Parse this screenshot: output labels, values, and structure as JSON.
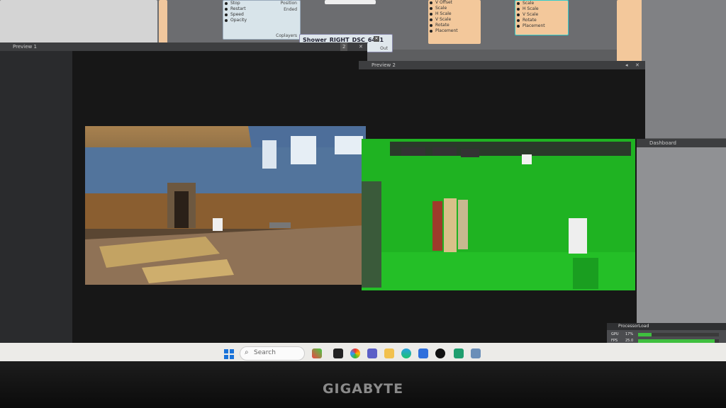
{
  "monitor": {
    "brand": "GIGABYTE"
  },
  "node_editor": {
    "node_c": {
      "ports": [
        "Stop",
        "Restart",
        "Speed",
        "Opacity"
      ],
      "outputs": [
        "Position",
        "Ended"
      ],
      "footer": "Coplayers"
    },
    "node_d": {
      "title": "Shower_RIGHT_DSC_6411",
      "output": "Out"
    },
    "node_f": {
      "ports": [
        "V Offset",
        "Scale",
        "H Scale",
        "V Scale",
        "Rotate",
        "Placement"
      ]
    },
    "node_g": {
      "ports": [
        "Scale",
        "H Scale",
        "V Scale",
        "Rotate",
        "Placement"
      ]
    }
  },
  "previews": [
    {
      "title": "Preview 1",
      "index": "2"
    },
    {
      "title": "Preview 2"
    }
  ],
  "dashboard": {
    "title": "Dashboard"
  },
  "processor_load": {
    "title": "ProcessorLoad",
    "rows": [
      {
        "label": "GPU",
        "value": "17%",
        "fraction": 0.17
      },
      {
        "label": "FPS",
        "value": "25.0",
        "fraction": 0.95
      }
    ]
  },
  "taskbar": {
    "search_placeholder": "Search"
  },
  "colors": {
    "green_screen": "#1fb322",
    "node_orange": "#f3c89b",
    "meter_fill": "#3fbf3f"
  }
}
